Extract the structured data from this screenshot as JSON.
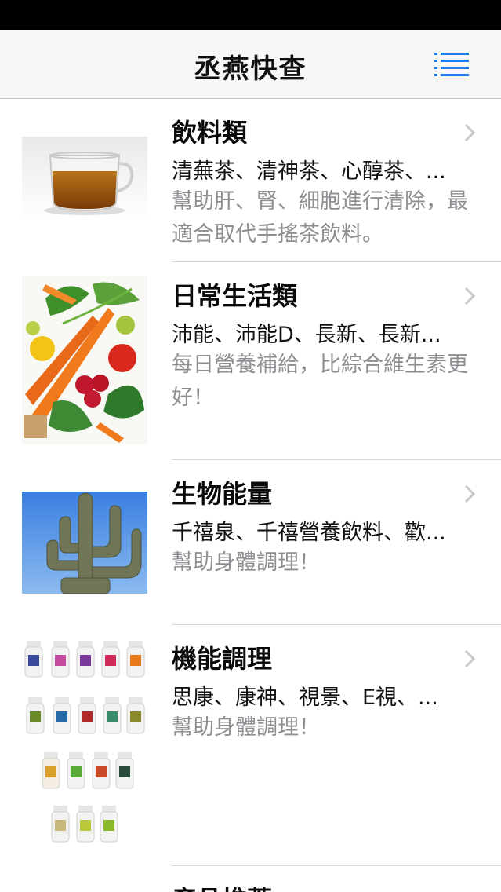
{
  "nav": {
    "title": "丞燕快查",
    "menu_icon": "menu-list-icon",
    "accent_color": "#1a7cf2"
  },
  "categories": [
    {
      "title": "飲料類",
      "items": "清蕪茶、清神茶、心醇茶、...",
      "desc": "幫助肝、腎、細胞進行清除，最適合取代手搖茶飲料。",
      "image": "tea-cup-image"
    },
    {
      "title": "日常生活類",
      "items": "沛能、沛能D、長新、長新...",
      "desc": "每日營養補給，比綜合維生素更好！",
      "image": "vegetables-image"
    },
    {
      "title": "生物能量",
      "items": "千禧泉、千禧營養飲料、歡...",
      "desc": "幫助身體調理！",
      "image": "cactus-image"
    },
    {
      "title": "機能調理",
      "items": "思康、康神、視景、E視、...",
      "desc": "幫助身體調理！",
      "image": "supplement-bottles-image"
    },
    {
      "title": "產品推薦",
      "items": "",
      "desc": "",
      "image": ""
    }
  ]
}
